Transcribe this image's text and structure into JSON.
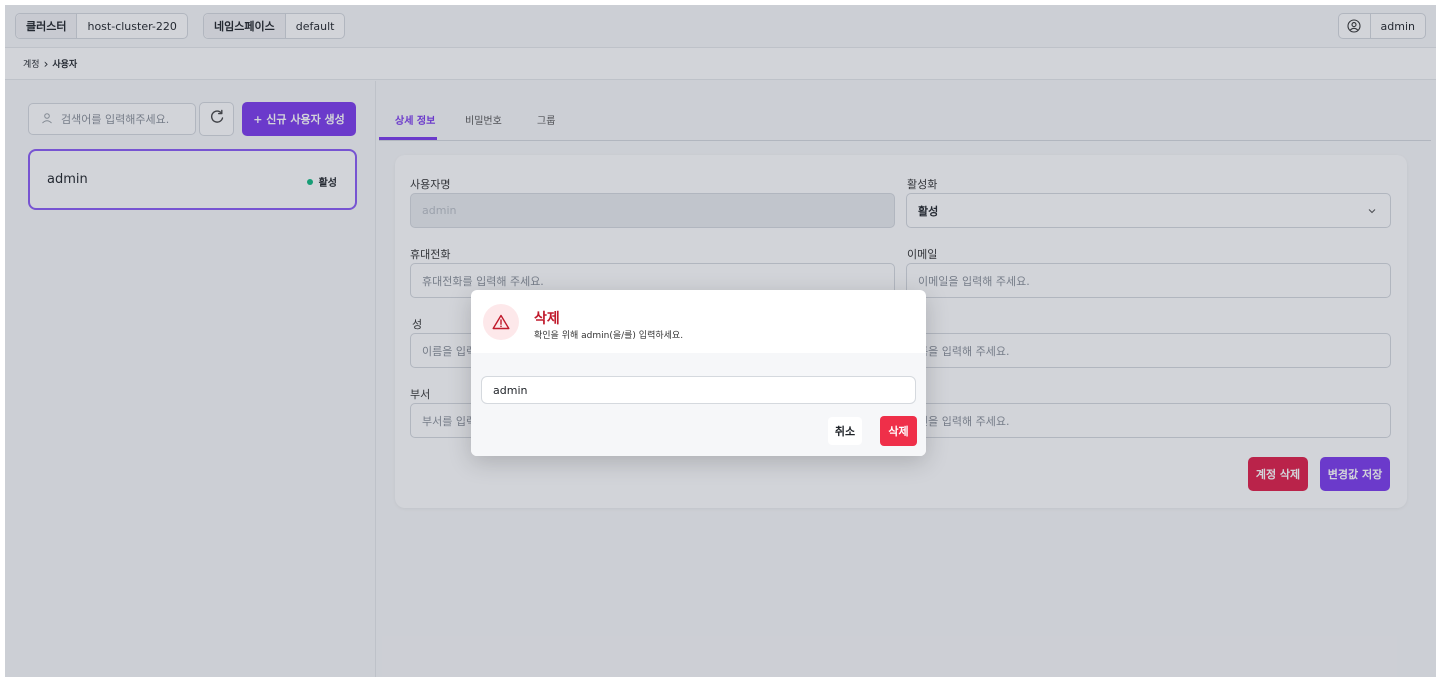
{
  "topbar": {
    "cluster": {
      "key": "클러스터",
      "value": "host-cluster-220"
    },
    "namespace": {
      "key": "네임스페이스",
      "value": "default"
    },
    "user": {
      "name": "admin",
      "icon": "user-circle-icon"
    }
  },
  "breadcrumb": {
    "parent": "계정",
    "separator": "›",
    "current": "사용자"
  },
  "left": {
    "search": {
      "placeholder": "검색어를 입력해주세요.",
      "icon": "user-icon"
    },
    "refresh_icon": "refresh-icon",
    "new_user_label": "+ 신규 사용자 생성",
    "users": [
      {
        "name": "admin",
        "status": "활성",
        "status_color": "#10b981"
      }
    ]
  },
  "tabs": [
    {
      "label": "상세 정보",
      "active": true
    },
    {
      "label": "비밀번호",
      "active": false
    },
    {
      "label": "그룹",
      "active": false
    }
  ],
  "form": {
    "username": {
      "label": "사용자명",
      "value": "admin"
    },
    "active": {
      "label": "활성화",
      "value": "활성"
    },
    "phone": {
      "label": "휴대전화",
      "placeholder": "휴대전화를 입력해 주세요."
    },
    "email": {
      "label": "이메일",
      "placeholder": "이메일을 입력해 주세요."
    },
    "last_name": {
      "label": "성",
      "placeholder": "이름을 입력"
    },
    "first_name": {
      "label": "",
      "placeholder": "름을 입력해 주세요."
    },
    "department": {
      "label": "부서",
      "placeholder": "부서를 입력"
    },
    "employee_no": {
      "label": "",
      "placeholder": "번을 입력해 주세요."
    },
    "delete_account_label": "계정 삭제",
    "save_label": "변경값 저장"
  },
  "modal": {
    "title": "삭제",
    "subtitle": "확인을 위해 admin(을/를) 입력하세요.",
    "input_value": "admin",
    "cancel_label": "취소",
    "confirm_label": "삭제",
    "icon": "warning-triangle-icon"
  },
  "colors": {
    "accent": "#7c3aed",
    "danger": "#e11d48",
    "success": "#10b981"
  }
}
